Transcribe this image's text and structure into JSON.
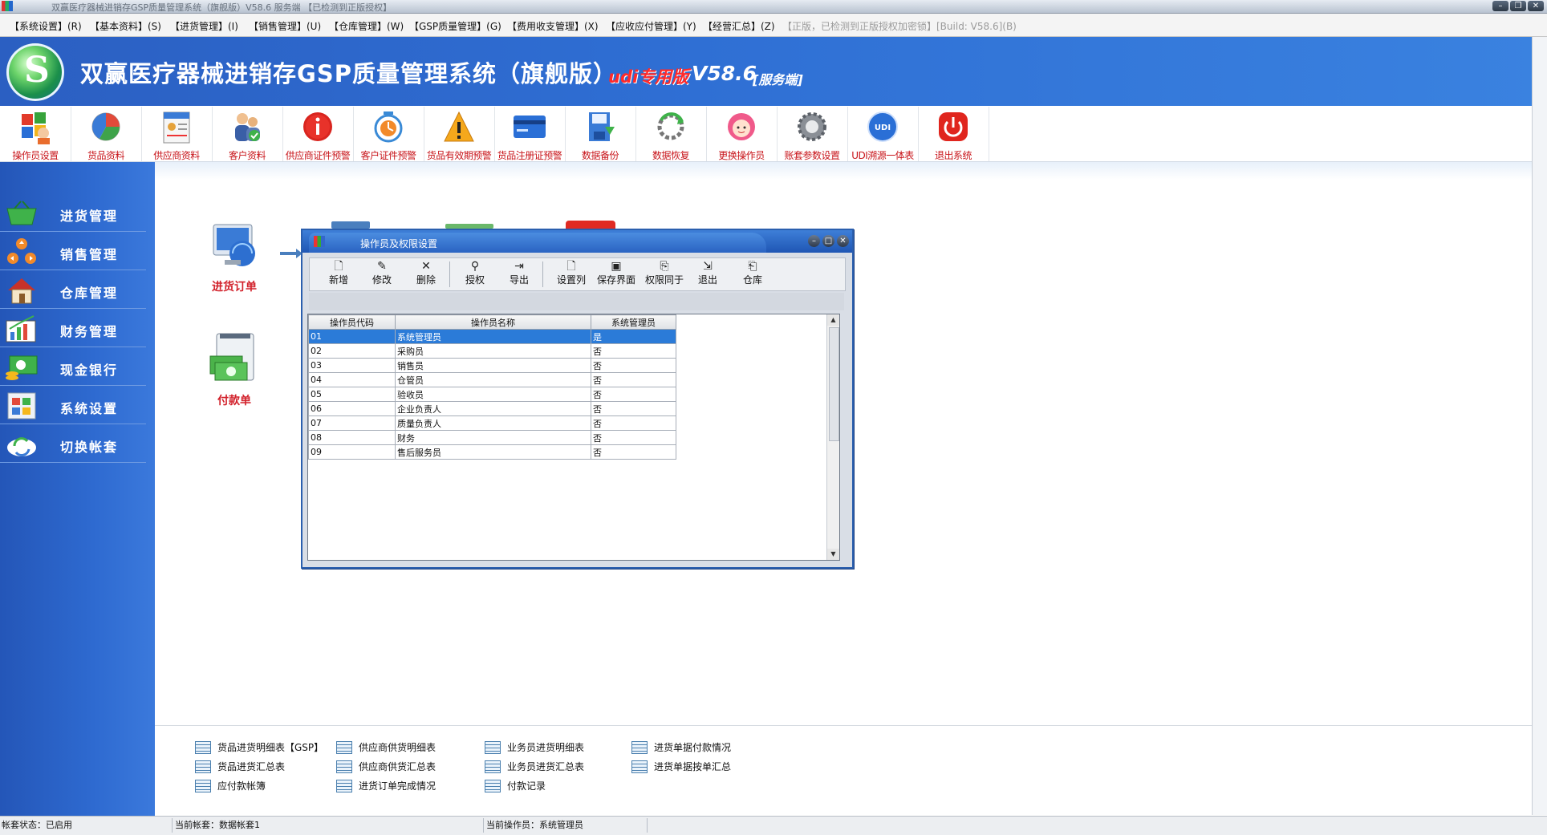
{
  "window": {
    "title": "双赢医疗器械进销存GSP质量管理系统（旗舰版）V58.6 服务端 【已检测到正版授权】"
  },
  "menubar": {
    "items": [
      "【系统设置】(R)",
      "【基本资料】(S)",
      "【进货管理】(I)",
      "【销售管理】(U)",
      "【仓库管理】(W)",
      "【GSP质量管理】(G)",
      "【费用收支管理】(X)",
      "【应收应付管理】(Y)",
      "【经营汇总】(Z)"
    ],
    "license": "【正版，已检测到正版授权加密锁】[Build: V58.6](B)"
  },
  "banner": {
    "title": "双赢医疗器械进销存GSP质量管理系统（旗舰版）",
    "edition": "udi专用版",
    "version": "V58.6",
    "server": "[服务端]"
  },
  "toolbar": {
    "items": [
      "操作员设置",
      "货品资料",
      "供应商资料",
      "客户资料",
      "供应商证件预警",
      "客户证件预警",
      "货品有效期预警",
      "货品注册证预警",
      "数据备份",
      "数据恢复",
      "更换操作员",
      "账套参数设置",
      "UDI溯源一体表",
      "退出系统"
    ],
    "udi_badge": "UDI"
  },
  "sidebar": {
    "items": [
      "进货管理",
      "销售管理",
      "仓库管理",
      "财务管理",
      "现金银行",
      "系统设置",
      "切换帐套"
    ]
  },
  "flow": {
    "purchase_order": "进货订单",
    "payment": "付款单"
  },
  "dialog": {
    "title": "操作员及权限设置",
    "tools": [
      "新增",
      "修改",
      "删除",
      "授权",
      "导出",
      "设置列",
      "保存界面",
      "权限同于",
      "退出",
      "仓库"
    ],
    "columns": [
      "操作员代码",
      "操作员名称",
      "系统管理员"
    ],
    "rows": [
      [
        "01",
        "系统管理员",
        "是"
      ],
      [
        "02",
        "采购员",
        "否"
      ],
      [
        "03",
        "销售员",
        "否"
      ],
      [
        "04",
        "仓管员",
        "否"
      ],
      [
        "05",
        "验收员",
        "否"
      ],
      [
        "06",
        "企业负责人",
        "否"
      ],
      [
        "07",
        "质量负责人",
        "否"
      ],
      [
        "08",
        "财务",
        "否"
      ],
      [
        "09",
        "售后服务员",
        "否"
      ]
    ],
    "selected_row": 0
  },
  "reports": {
    "col1": [
      "货品进货明细表【GSP】",
      "货品进货汇总表",
      "应付款帐簿"
    ],
    "col2": [
      "供应商供货明细表",
      "供应商供货汇总表",
      "进货订单完成情况"
    ],
    "col3": [
      "业务员进货明细表",
      "业务员进货汇总表",
      "付款记录"
    ],
    "col4": [
      "进货单据付款情况",
      "进货单据按单汇总"
    ]
  },
  "status": {
    "account_state": "帐套状态：已启用",
    "current_account": "当前帐套：数据帐套1",
    "current_operator": "当前操作员：系统管理员"
  },
  "colors": {
    "brand_blue": "#2e6ad0",
    "toolbar_label": "#c8141a",
    "selected_row": "#2b7bd8",
    "flow_label": "#d2202a"
  }
}
